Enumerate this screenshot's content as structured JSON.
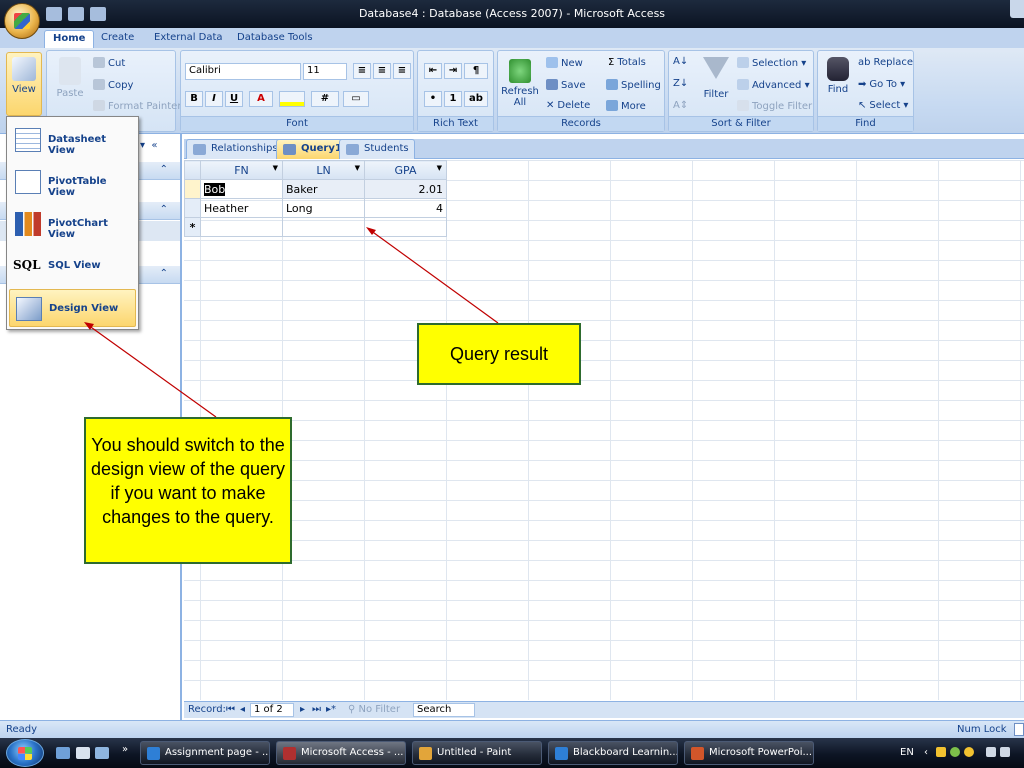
{
  "window": {
    "title": "Database4 : Database (Access 2007) - Microsoft Access"
  },
  "ribbon_tabs": [
    "Home",
    "Create",
    "External Data",
    "Database Tools"
  ],
  "ribbon": {
    "view_label": "View",
    "clipboard": {
      "paste": "Paste",
      "cut": "Cut",
      "copy": "Copy",
      "format_painter": "Format Painter"
    },
    "font": {
      "name": "Calibri",
      "size": "11",
      "group_label": "Font",
      "bold": "B",
      "italic": "I",
      "underline": "U"
    },
    "rich_text": {
      "group_label": "Rich Text"
    },
    "records": {
      "refresh": "Refresh All",
      "new": "New",
      "save": "Save",
      "delete": "Delete",
      "totals": "Totals",
      "spelling": "Spelling",
      "more": "More",
      "group_label": "Records"
    },
    "sort_filter": {
      "filter": "Filter",
      "selection": "Selection",
      "advanced": "Advanced",
      "toggle_filter": "Toggle Filter",
      "group_label": "Sort & Filter"
    },
    "find": {
      "find": "Find",
      "replace": "Replace",
      "goto": "Go To",
      "select": "Select",
      "group_label": "Find"
    }
  },
  "view_menu": [
    {
      "label": "Datasheet View",
      "icon": "datasheet-icon"
    },
    {
      "label": "PivotTable View",
      "icon": "pivottable-icon"
    },
    {
      "label": "PivotChart View",
      "icon": "pivotchart-icon"
    },
    {
      "label": "SQL View",
      "icon": "sql-icon",
      "icon_text": "SQL"
    },
    {
      "label": "Design View",
      "icon": "design-icon",
      "highlighted": true
    }
  ],
  "doc_tabs": [
    {
      "label": "Relationships",
      "active": false
    },
    {
      "label": "Query1",
      "active": true
    },
    {
      "label": "Students",
      "active": false
    }
  ],
  "datasheet": {
    "columns": [
      "FN",
      "LN",
      "GPA"
    ],
    "rows": [
      [
        "Bob",
        "Baker",
        "2.01"
      ],
      [
        "Heather",
        "Long",
        "4"
      ]
    ],
    "new_row_marker": "*"
  },
  "record_nav": {
    "label": "Record:",
    "current": "1 of 2",
    "no_filter": "No Filter",
    "search": "Search"
  },
  "status": {
    "left": "Ready",
    "right": "Num Lock"
  },
  "taskbar": {
    "items": [
      "Assignment page - ...",
      "Microsoft Access - ...",
      "Untitled - Paint",
      "Blackboard Learnin...",
      "Microsoft PowerPoi..."
    ],
    "lang": "EN"
  },
  "callouts": {
    "query_result": "Query result",
    "design_view_note": "You should switch to the design view of the query if you want to make changes to the query."
  },
  "colors": {
    "callout_bg": "#ffff00",
    "arrow": "#c00000",
    "ribbon": "#c6d9f1"
  }
}
